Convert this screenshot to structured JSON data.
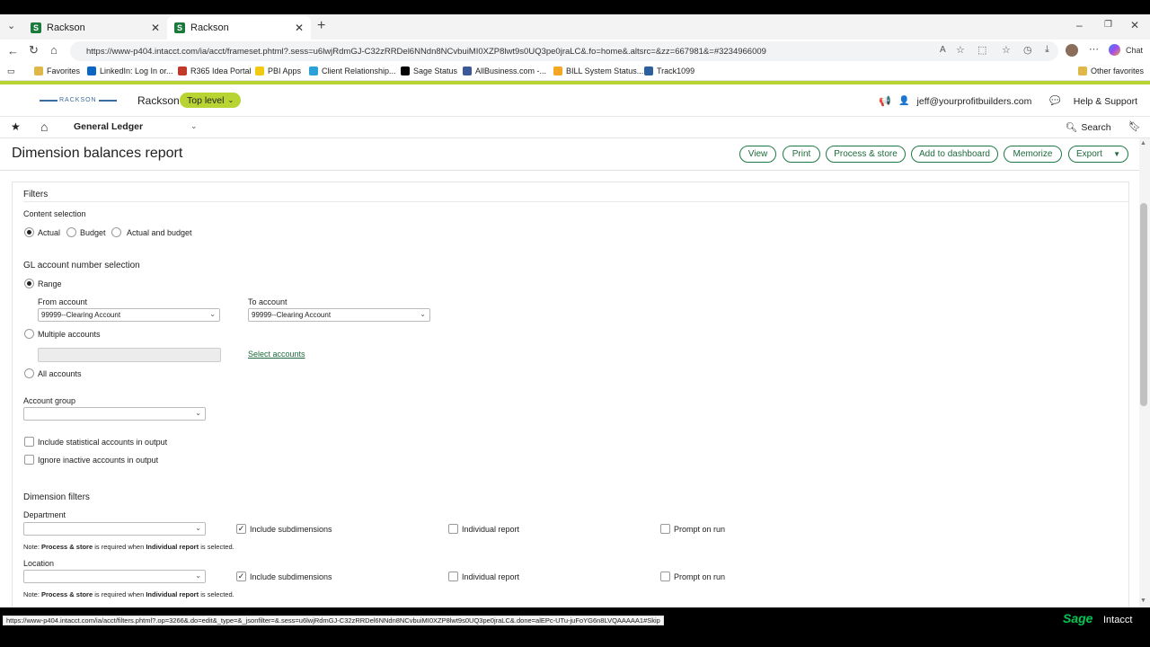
{
  "browser": {
    "tabs": [
      {
        "label": "Rackson"
      },
      {
        "label": "Rackson"
      }
    ],
    "url": "https://www-p404.intacct.com/ia/acct/frameset.phtml?.sess=u6lwjRdmGJ-C32zRRDel6NNdn8NCvbuiMI0XZP8lwt9s0UQ3pe0jraLC&.fo=home&.altsrc=&zz=667981&=#3234966009",
    "favorites": [
      {
        "label": "Favorites",
        "color": "#e0b84a"
      },
      {
        "label": "LinkedIn: Log In or...",
        "color": "#0a66c2"
      },
      {
        "label": "R365 Idea Portal",
        "color": "#c0392b"
      },
      {
        "label": "PBI Apps",
        "color": "#f2c811"
      },
      {
        "label": "Client Relationship...",
        "color": "#2aa1d8"
      },
      {
        "label": "Sage Status",
        "color": "#000000"
      },
      {
        "label": "AllBusiness.com -...",
        "color": "#3b5998"
      },
      {
        "label": "BILL System Status...",
        "color": "#f5a623"
      },
      {
        "label": "Track1099",
        "color": "#2c5f9e"
      }
    ],
    "other_favorites": "Other favorites",
    "chat": "Chat",
    "status_url": "https://www-p404.intacct.com/ia/acct/filters.phtml?.op=3266&.do=edit&_type=&_jsonfilter=&.sess=u6lwjRdmGJ-C32zRRDel6NNdn8NCvbuiMI0XZP8lwt9s0UQ3pe0jraLC&.done=alEPc-UTu-juFoYG6n8LVQAAAAA1#Skip"
  },
  "app": {
    "logo": "RACKSON",
    "company": "Rackson",
    "level": "Top level",
    "user": "jeff@yourprofitbuilders.com",
    "help": "Help & Support",
    "module": "General Ledger",
    "search": "Search",
    "brand_sage": "Sage",
    "brand_intacct": "Intacct"
  },
  "page": {
    "title": "Dimension balances report",
    "buttons": {
      "view": "View",
      "print": "Print",
      "process": "Process & store",
      "dashboard": "Add to dashboard",
      "memorize": "Memorize",
      "export": "Export"
    }
  },
  "filters": {
    "heading": "Filters",
    "content_selection": {
      "label": "Content selection",
      "options": [
        "Actual",
        "Budget",
        "Actual and budget"
      ],
      "selected": "Actual"
    },
    "gl_selection": {
      "label": "GL account number selection",
      "range": "Range",
      "from_label": "From account",
      "from_value": "99999--Clearing Account",
      "to_label": "To account",
      "to_value": "99999--Clearing Account",
      "multiple": "Multiple accounts",
      "select_accounts": "Select accounts",
      "all": "All accounts"
    },
    "account_group": {
      "label": "Account group",
      "value": ""
    },
    "include_statistical": "Include statistical accounts in output",
    "ignore_inactive": "Ignore inactive accounts in output"
  },
  "dimension_filters": {
    "heading": "Dimension filters",
    "include_sub": "Include subdimensions",
    "individual": "Individual report",
    "prompt": "Prompt on run",
    "note_prefix": "Note: ",
    "note_process": "Process & store",
    "note_mid": " is required when ",
    "note_individual": "Individual report",
    "note_suffix": " is selected.",
    "department": {
      "label": "Department",
      "value": ""
    },
    "location": {
      "label": "Location",
      "value": ""
    }
  },
  "colors": {
    "accent": "#b8d432",
    "button_text": "#1e6b3c",
    "sage_green": "#00c853"
  }
}
